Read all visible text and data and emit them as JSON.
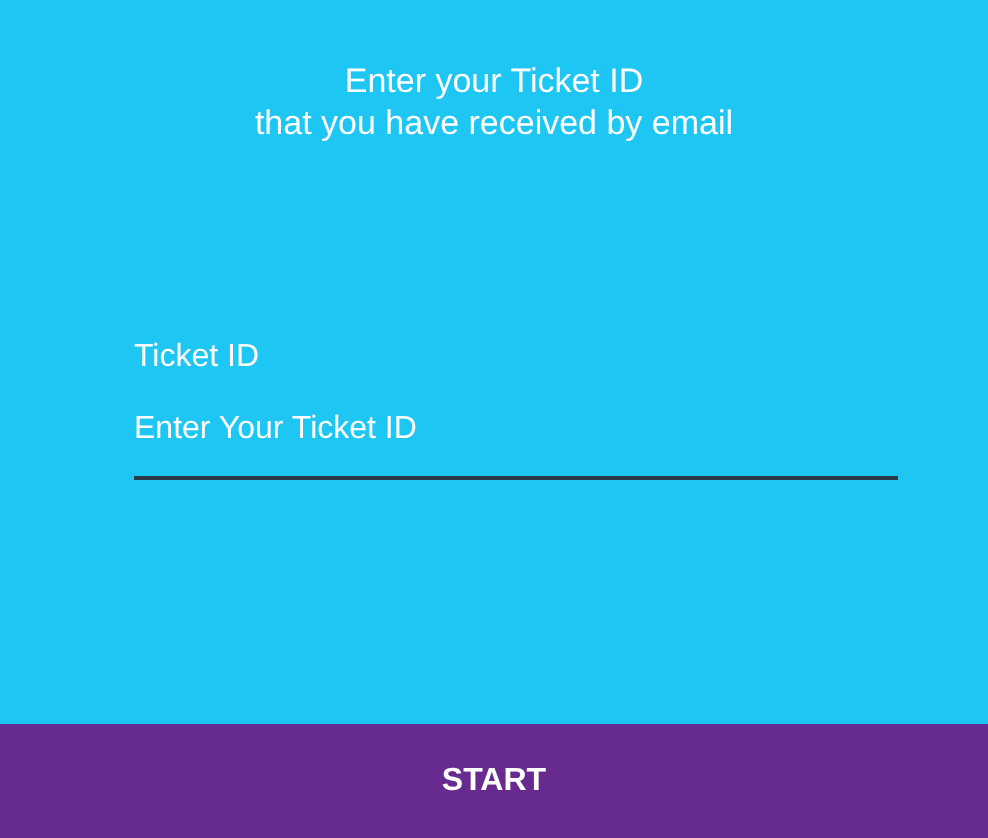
{
  "heading": {
    "lines": [
      "Enter your Ticket ID",
      "that you have received by email"
    ]
  },
  "ticket_field": {
    "label": "Ticket ID",
    "placeholder": "Enter Your Ticket ID"
  },
  "start_button": {
    "label": "START"
  }
}
